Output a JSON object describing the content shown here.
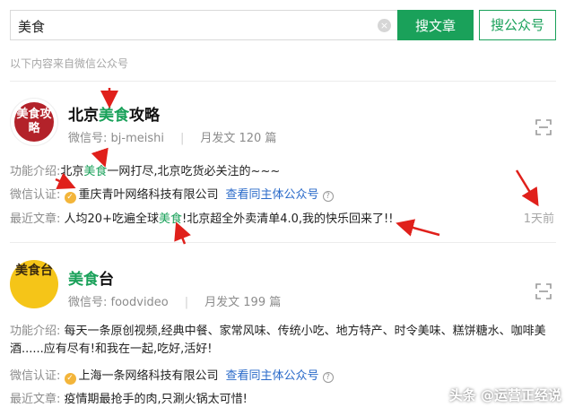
{
  "search": {
    "query": "美食",
    "clear_glyph": "×",
    "btn_article": "搜文章",
    "btn_account": "搜公众号",
    "hint": "以下内容来自微信公众号"
  },
  "results": [
    {
      "avatar_text": "美食攻略",
      "name_pre": "北京",
      "name_hl": "美食",
      "name_post": "攻略",
      "wechat_id": "微信号: bj-meishi",
      "monthly": "月发文 120 篇",
      "intro_label": "功能介绍:",
      "intro_pre": "北京",
      "intro_hl": "美食",
      "intro_post": "一网打尽,北京吃货必关注的~~~",
      "cert_label": "微信认证:",
      "cert_company": "重庆青叶网络科技有限公司",
      "cert_link": "查看同主体公众号",
      "recent_label": "最近文章:",
      "recent_pre": "人均20+吃遍全球",
      "recent_hl": "美食",
      "recent_post": "!北京超全外卖清单4.0,我的快乐回来了!!",
      "time": "1天前"
    },
    {
      "avatar_text": "美食台",
      "name_pre": "",
      "name_hl": "美食",
      "name_post": "台",
      "wechat_id": "微信号: foodvideo",
      "monthly": "月发文 199 篇",
      "intro_label": "功能介绍:",
      "intro_text": "每天一条原创视频,经典中餐、家常风味、传统小吃、地方特产、时令美味、糕饼糖水、咖啡美酒......应有尽有!和我在一起,吃好,活好!",
      "cert_label": "微信认证:",
      "cert_company": "上海一条网络科技有限公司",
      "cert_link": "查看同主体公众号",
      "recent_label": "最近文章:",
      "recent_text": "疫情期最抢手的肉,只涮火锅太可惜!"
    }
  ],
  "watermark": "头条 @运营正经说",
  "colors": {
    "accent": "#1aa15a",
    "link": "#2a6ac9",
    "annotation_arrow": "#e0201b"
  }
}
